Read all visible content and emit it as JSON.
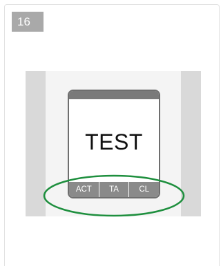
{
  "step": {
    "number": "16"
  },
  "cartridge": {
    "label": "TEST",
    "sections": [
      "ACT",
      "TA",
      "CL"
    ]
  },
  "colors": {
    "highlight": "#1e8f3e",
    "badge": "#a9a9a9",
    "rail": "#d9d9d9",
    "cartridge_border": "#6e6e6e"
  }
}
